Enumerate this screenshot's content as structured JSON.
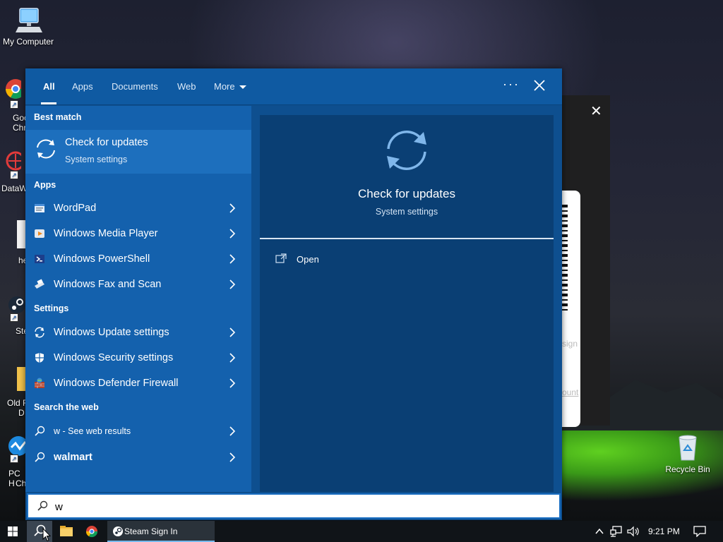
{
  "desktop": {
    "icons": [
      {
        "name": "my-computer",
        "label": "My Computer"
      },
      {
        "name": "recycle-bin",
        "label": "Recycle Bin"
      }
    ],
    "side_labels": [
      "Goo",
      "Chr",
      "DataW",
      "he",
      "Ste",
      "Old F",
      "D",
      "PC H",
      "Ch"
    ]
  },
  "steam_window": {
    "close": "✕",
    "sign_text": "sign",
    "account_text": "ount"
  },
  "search": {
    "tabs": [
      {
        "label": "All",
        "active": true
      },
      {
        "label": "Apps"
      },
      {
        "label": "Documents"
      },
      {
        "label": "Web"
      },
      {
        "label": "More"
      }
    ],
    "more_dots": "···",
    "sections": {
      "best_match": "Best match",
      "apps": "Apps",
      "settings": "Settings",
      "web": "Search the web"
    },
    "best_match": {
      "title": "Check for updates",
      "subtitle": "System settings"
    },
    "apps": [
      {
        "label": "WordPad"
      },
      {
        "label": "Windows Media Player"
      },
      {
        "label": "Windows PowerShell"
      },
      {
        "label": "Windows Fax and Scan"
      }
    ],
    "settings": [
      {
        "label": "Windows Update settings"
      },
      {
        "label": "Windows Security settings"
      },
      {
        "label": "Windows Defender Firewall"
      }
    ],
    "web": [
      {
        "label": "w - See web results"
      },
      {
        "label": "walmart"
      }
    ],
    "detail": {
      "title": "Check for updates",
      "subtitle": "System settings",
      "open_label": "Open"
    },
    "query": "w",
    "accent": "#0f5aa2"
  },
  "taskbar": {
    "steam_label": "Steam Sign In",
    "clock": "9:21 PM"
  }
}
